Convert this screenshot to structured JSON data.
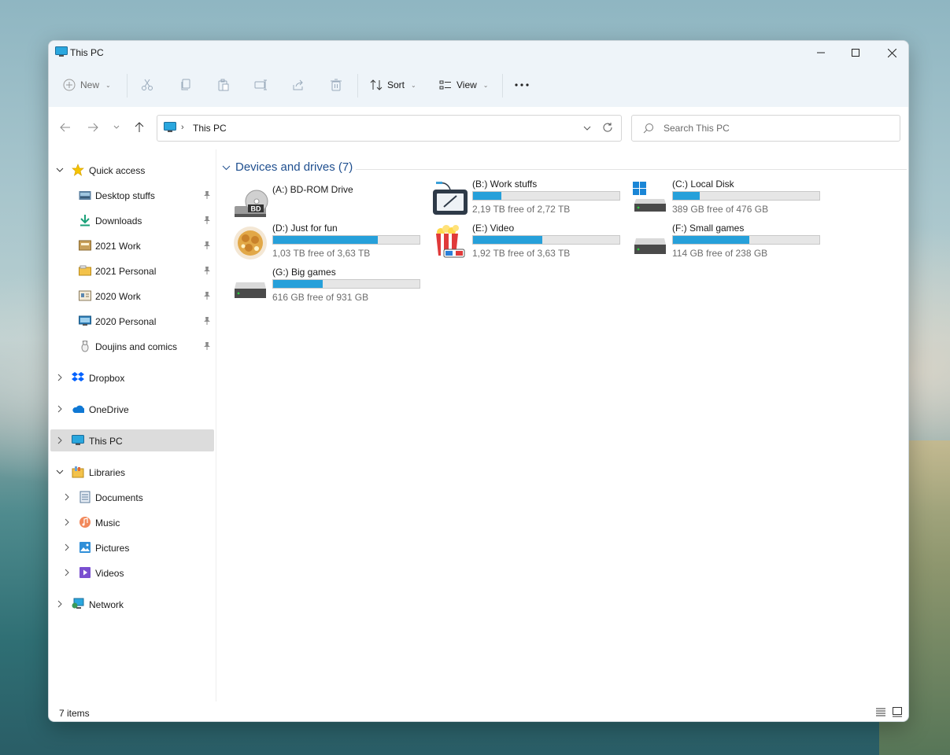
{
  "window": {
    "title": "This PC"
  },
  "toolbar": {
    "new_label": "New",
    "sort_label": "Sort",
    "view_label": "View"
  },
  "address": {
    "path": "This PC",
    "separator": "›"
  },
  "search": {
    "placeholder": "Search This PC"
  },
  "sidebar": {
    "quick_access": {
      "label": "Quick access",
      "items": [
        {
          "label": "Desktop stuffs",
          "icon": "desktop-folder-icon"
        },
        {
          "label": "Downloads",
          "icon": "downloads-icon"
        },
        {
          "label": "2021 Work",
          "icon": "folder-icon"
        },
        {
          "label": "2021 Personal",
          "icon": "folder-icon"
        },
        {
          "label": "2020 Work",
          "icon": "folder-icon"
        },
        {
          "label": "2020 Personal",
          "icon": "folder-icon"
        },
        {
          "label": "Doujins and comics",
          "icon": "folder-icon"
        }
      ]
    },
    "dropbox": "Dropbox",
    "onedrive": "OneDrive",
    "this_pc": "This PC",
    "libraries": {
      "label": "Libraries",
      "items": [
        {
          "label": "Documents",
          "icon": "documents-icon"
        },
        {
          "label": "Music",
          "icon": "music-icon"
        },
        {
          "label": "Pictures",
          "icon": "pictures-icon"
        },
        {
          "label": "Videos",
          "icon": "videos-icon"
        }
      ]
    },
    "network": "Network"
  },
  "content": {
    "group_title": "Devices and drives (7)",
    "drives": [
      {
        "name": "(A:) BD-ROM Drive",
        "free": "",
        "used_fraction": null,
        "icon": "bd-rom-icon"
      },
      {
        "name": "(B:) Work stuffs",
        "free": "2,19 TB free of 2,72 TB",
        "used_fraction": 0.195,
        "icon": "drawing-tablet-icon"
      },
      {
        "name": "(C:) Local Disk",
        "free": "389 GB free of 476 GB",
        "used_fraction": 0.183,
        "icon": "windows-drive-icon"
      },
      {
        "name": "(D:) Just for fun",
        "free": "1,03 TB free of 3,63 TB",
        "used_fraction": 0.716,
        "icon": "cookie-icon"
      },
      {
        "name": "(E:) Video",
        "free": "1,92 TB free of 3,63 TB",
        "used_fraction": 0.471,
        "icon": "popcorn-icon"
      },
      {
        "name": "(F:) Small games",
        "free": "114 GB free of 238 GB",
        "used_fraction": 0.521,
        "icon": "hard-drive-icon"
      },
      {
        "name": "(G:) Big games",
        "free": "616 GB free of 931 GB",
        "used_fraction": 0.338,
        "icon": "hard-drive-icon"
      }
    ]
  },
  "status": {
    "items_count": "7 items"
  },
  "colors": {
    "accent": "#26a0da",
    "header_blue": "#1f4f8f",
    "selected_bg": "#dcdcdc"
  }
}
